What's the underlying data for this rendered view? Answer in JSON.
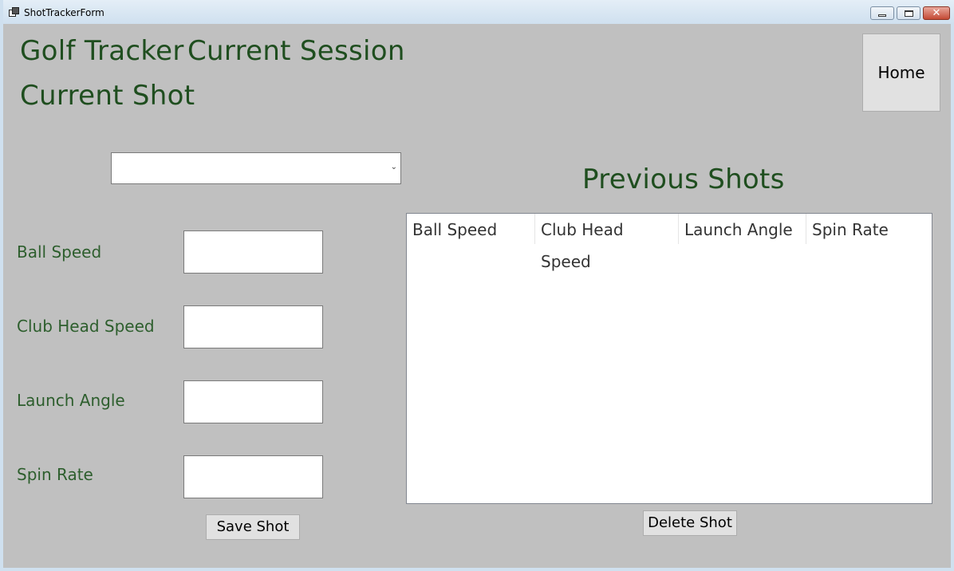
{
  "window": {
    "title": "ShotTrackerForm"
  },
  "headings": {
    "app_title": "Golf Tracker",
    "session_title": "Current Session",
    "shot_title": "Current Shot",
    "previous_shots": "Previous Shots"
  },
  "form": {
    "club_select_value": "",
    "fields": [
      {
        "label": "Ball Speed",
        "value": ""
      },
      {
        "label": "Club Head Speed",
        "value": ""
      },
      {
        "label": "Launch Angle",
        "value": ""
      },
      {
        "label": "Spin Rate",
        "value": ""
      }
    ],
    "save_label": "Save Shot"
  },
  "table": {
    "columns": [
      "Ball Speed",
      "Club Head Speed",
      "Launch Angle",
      "Spin Rate"
    ],
    "rows": []
  },
  "buttons": {
    "home_label": "Home",
    "delete_label": "Delete Shot"
  },
  "colors": {
    "heading_green": "#1f4e1f",
    "form_background": "#c0c0c0"
  }
}
